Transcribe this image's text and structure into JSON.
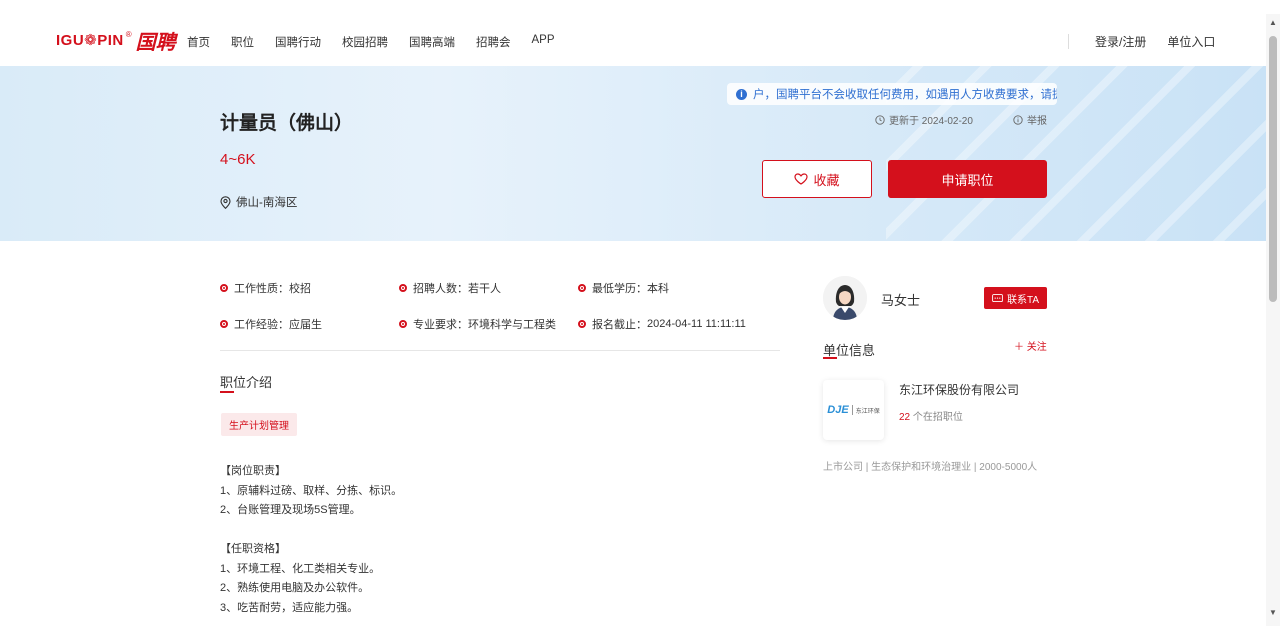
{
  "brand": {
    "logo_text": "IGU❁PIN",
    "logo_reg": "®",
    "logo_cn": "国聘"
  },
  "nav": {
    "items": [
      "首页",
      "职位",
      "国聘行动",
      "校园招聘",
      "国聘高端",
      "招聘会",
      "APP"
    ],
    "login": "登录/注册",
    "employer": "单位入口"
  },
  "job": {
    "title": "计量员（佛山）",
    "salary": "4~6K",
    "location": "佛山-南海区",
    "notice": "户，国聘平台不会收取任何费用，如遇用人方收费要求，请提",
    "updated": "更新于 2024-02-20",
    "report": "举报",
    "favorite_label": "收藏",
    "apply_label": "申请职位"
  },
  "attributes": [
    {
      "label": "工作性质：",
      "value": "校招"
    },
    {
      "label": "招聘人数：",
      "value": "若干人"
    },
    {
      "label": "最低学历：",
      "value": "本科"
    },
    {
      "label": "工作经验：",
      "value": "应届生"
    },
    {
      "label": "专业要求：",
      "value": "环境科学与工程类"
    },
    {
      "label": "报名截止：",
      "value": "2024-04-11 11:11:11"
    }
  ],
  "intro": {
    "title": "职位介绍",
    "tag": "生产计划管理",
    "duties_heading": "【岗位职责】",
    "duties": [
      "1、原辅料过磅、取样、分拣、标识。",
      "2、台账管理及现场5S管理。"
    ],
    "req_heading": "【任职资格】",
    "requirements": [
      "1、环境工程、化工类相关专业。",
      "2、熟练使用电脑及办公软件。",
      "3、吃苦耐劳，适应能力强。"
    ]
  },
  "contact": {
    "name": "马女士",
    "button": "联系TA"
  },
  "unit": {
    "title": "单位信息",
    "follow": "＋ 关注",
    "company_name": "东江环保股份有限公司",
    "logo_mark": "DJE",
    "logo_text": "东江环保",
    "jobs_count": "22",
    "jobs_suffix": " 个在招职位",
    "meta": "上市公司 | 生态保护和环境治理业 | 2000-5000人"
  },
  "colors": {
    "accent": "#d4101c",
    "notice_blue": "#2f6fd1"
  }
}
